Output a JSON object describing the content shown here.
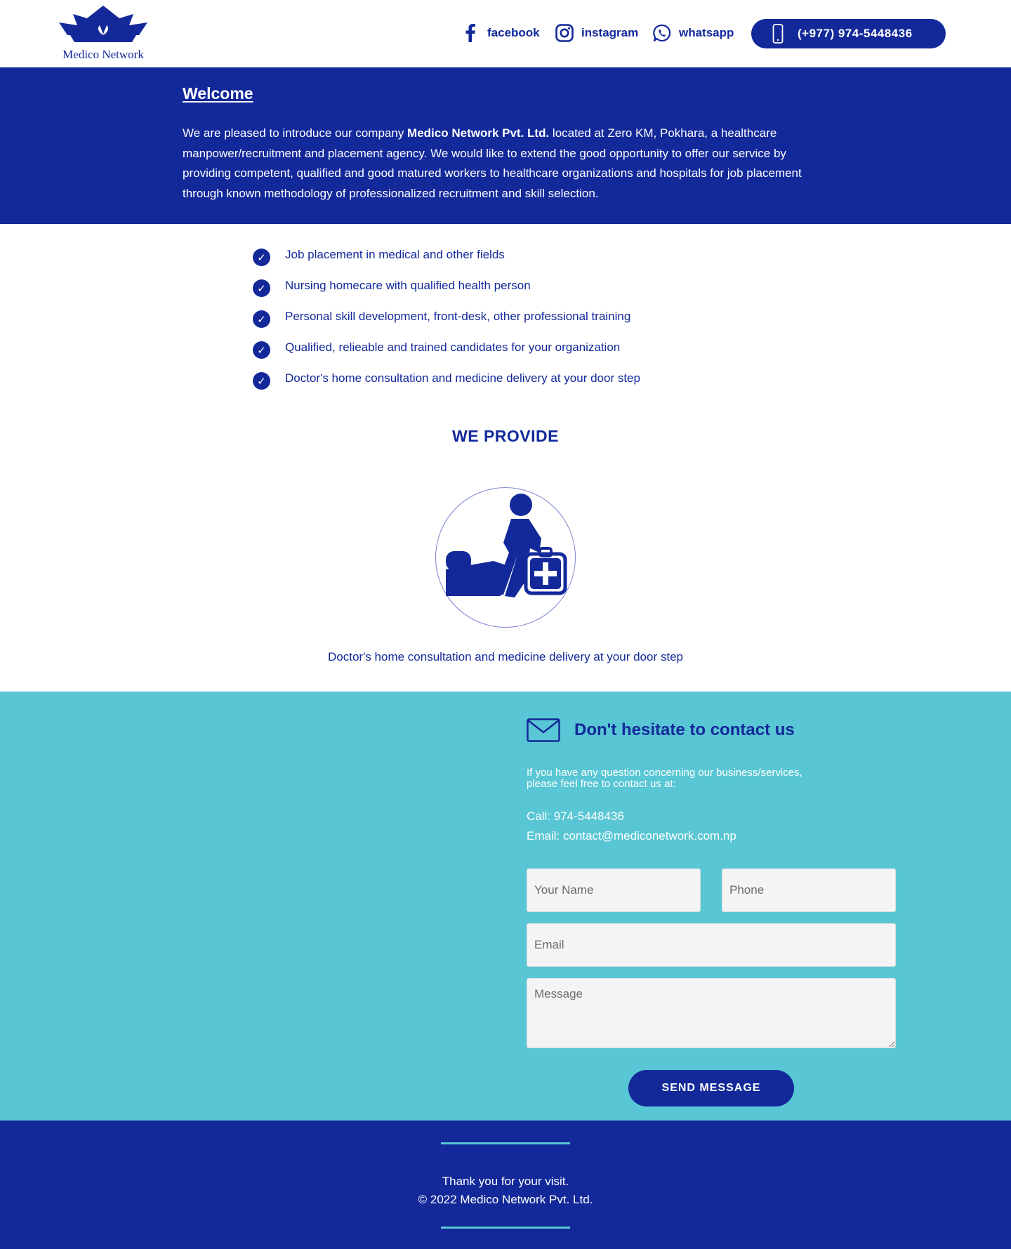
{
  "header": {
    "logo_text": "Medico Network",
    "social": [
      {
        "icon": "facebook-icon",
        "label": "facebook"
      },
      {
        "icon": "instagram-icon",
        "label": "instagram"
      },
      {
        "icon": "whatsapp-icon",
        "label": "whatsapp"
      }
    ],
    "phone_label": "(+977) 974-5448436"
  },
  "welcome": {
    "title": "Welcome",
    "text_before": "We are pleased to introduce our company ",
    "company": "Medico Network Pvt. Ltd.",
    "text_after": " located at Zero KM, Pokhara, a healthcare manpower/recruitment and placement agency. We would like to extend the good opportunity to offer our service by providing competent, qualified and good matured workers to healthcare organizations and hospitals for job placement through known methodology of professionalized recruitment and skill selection."
  },
  "features": [
    "Job placement in medical and other fields",
    "Nursing homecare with qualified health person",
    "Personal skill development, front-desk, other professional training",
    "Qualified, relieable and trained candidates for your organization",
    "Doctor's home consultation and medicine delivery at your door step"
  ],
  "check_glyph": "✓",
  "provide": {
    "title": "WE PROVIDE",
    "icon": "home-care-doctor-icon",
    "caption": "Doctor's home consultation and medicine delivery at your door step"
  },
  "contact": {
    "title": "Don't hesitate to contact us",
    "intro_line1": "If you have any question concerning our business/services,",
    "intro_line2": "please feel free to contact us at:",
    "call": "Call: 974-5448436",
    "email": "Email: contact@mediconetwork.com.np",
    "form": {
      "name_placeholder": "Your Name",
      "phone_placeholder": "Phone",
      "email_placeholder": "Email",
      "message_placeholder": "Message",
      "send_label": "SEND MESSAGE"
    }
  },
  "footer": {
    "line1": "Thank you for your visit.",
    "line2": "© 2022 Medico Network Pvt. Ltd."
  },
  "colors": {
    "primary": "#13299a",
    "accent": "#58c6d4",
    "white": "#ffffff"
  }
}
